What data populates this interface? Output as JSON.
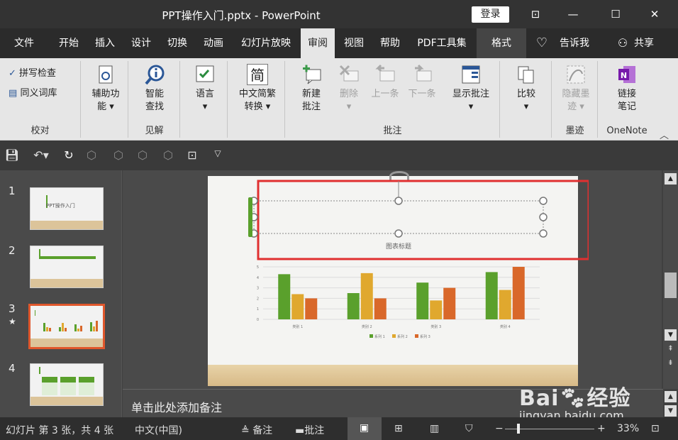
{
  "window": {
    "title": "PPT操作入门.pptx  -  PowerPoint",
    "login": "登录"
  },
  "tabs": [
    "文件",
    "开始",
    "插入",
    "设计",
    "切换",
    "动画",
    "幻灯片放映",
    "审阅",
    "视图",
    "帮助",
    "PDF工具集",
    "格式",
    "告诉我",
    "共享"
  ],
  "ribbon": {
    "proofing": {
      "spell": "拼写检查",
      "thesaurus": "同义词库",
      "label": "校对"
    },
    "accessibility": {
      "btn1": "辅助功",
      "btn2": "能"
    },
    "insights": {
      "btn1": "智能",
      "btn2": "查找",
      "label": "见解"
    },
    "language": {
      "btn": "语言"
    },
    "chinese": {
      "btn1": "中文简繁",
      "btn2": "转换",
      "icon_glyph": "简"
    },
    "comments": {
      "new1": "新建",
      "new2": "批注",
      "delete": "删除",
      "prev": "上一条",
      "next": "下一条",
      "show": "显示批注",
      "label": "批注"
    },
    "compare": {
      "btn": "比较"
    },
    "ink": {
      "btn1": "隐藏墨",
      "btn2": "迹",
      "label": "墨迹"
    },
    "onenote": {
      "btn1": "链接",
      "btn2": "笔记",
      "label": "OneNote"
    }
  },
  "slides": [
    {
      "num": "1",
      "text": "PPT操作入门"
    },
    {
      "num": "2"
    },
    {
      "num": "3",
      "star": "★"
    },
    {
      "num": "4"
    }
  ],
  "main_slide": {
    "chart_title": "图表标题"
  },
  "chart_data": {
    "type": "bar",
    "categories": [
      "类别 1",
      "类别 2",
      "类别 3",
      "类别 4"
    ],
    "series": [
      {
        "name": "系列 1",
        "values": [
          4.3,
          2.5,
          3.5,
          4.5
        ],
        "color": "#5aa02c"
      },
      {
        "name": "系列 2",
        "values": [
          2.4,
          4.4,
          1.8,
          2.8
        ],
        "color": "#e0a82e"
      },
      {
        "name": "系列 3",
        "values": [
          2.0,
          2.0,
          3.0,
          5.0
        ],
        "color": "#d9682a"
      }
    ],
    "y_ticks": [
      "0",
      "1",
      "2",
      "3",
      "4",
      "5"
    ],
    "ylim": [
      0,
      5
    ],
    "title": "图表标题",
    "legend": "bottom"
  },
  "notes": {
    "placeholder": "单击此处添加备注"
  },
  "status": {
    "slide_info": "幻灯片 第 3 张，共 4 张",
    "language": "中文(中国)",
    "notes": "备注",
    "comments": "批注",
    "zoom": "33%",
    "zoom_minus": "−",
    "zoom_plus": "+"
  },
  "watermark": {
    "brand": "Bai",
    "brand2": "经验",
    "url": "jingyan.baidu.com"
  }
}
